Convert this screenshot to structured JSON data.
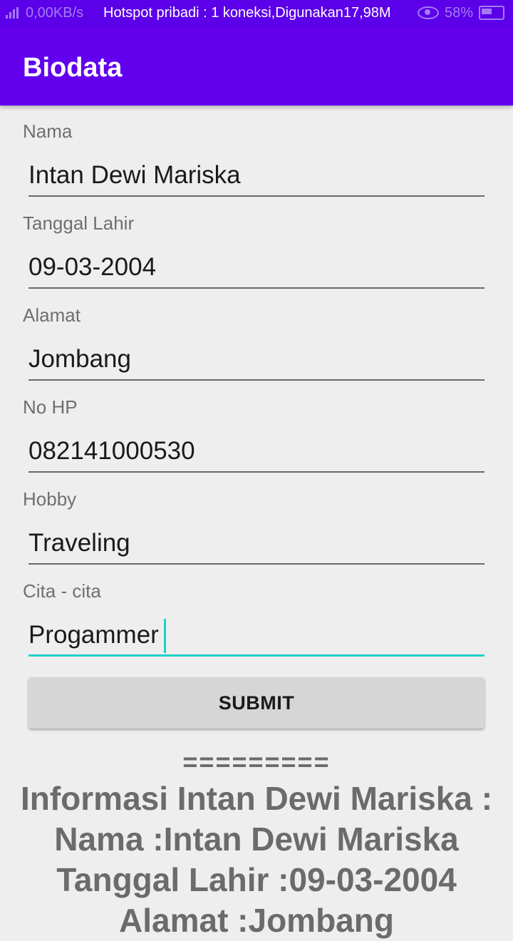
{
  "status_bar": {
    "data_speed": "0,00KB/s",
    "hotspot_text": "Hotspot pribadi : 1 koneksi,Digunakan17,98M",
    "battery_percent": "58%"
  },
  "app_bar": {
    "title": "Biodata"
  },
  "form": {
    "fields": [
      {
        "label": "Nama",
        "value": "Intan Dewi Mariska"
      },
      {
        "label": "Tanggal Lahir",
        "value": "09-03-2004"
      },
      {
        "label": "Alamat",
        "value": "Jombang"
      },
      {
        "label": "No HP",
        "value": "082141000530"
      },
      {
        "label": "Hobby",
        "value": "Traveling"
      },
      {
        "label": "Cita - cita",
        "value": "Progammer"
      }
    ],
    "submit_label": "SUBMIT"
  },
  "output": {
    "separator": "=========",
    "lines": [
      "Informasi Intan Dewi Mariska :",
      "Nama :Intan Dewi Mariska",
      "Tanggal Lahir :09-03-2004",
      "Alamat :Jombang"
    ]
  },
  "colors": {
    "app_bar": "#6200ee",
    "accent": "#1ad2c8",
    "background": "#eeeeee"
  }
}
